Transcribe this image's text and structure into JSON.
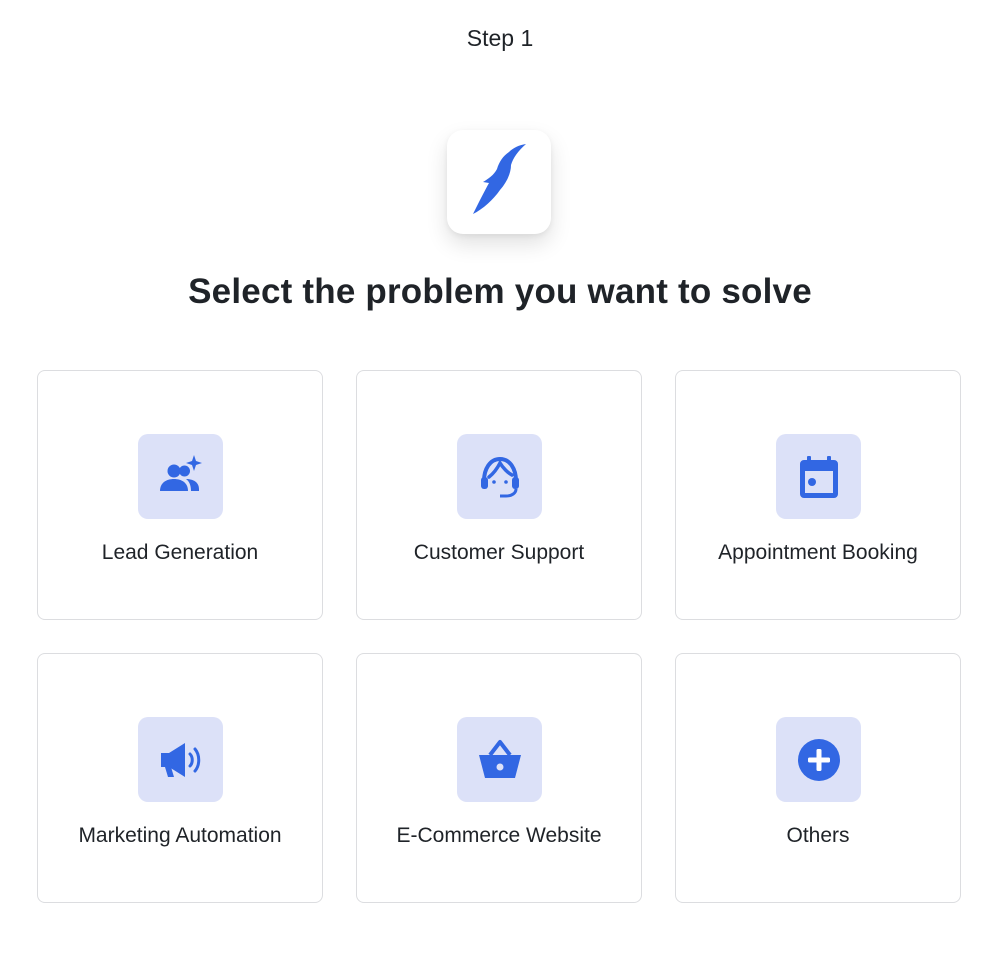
{
  "header": {
    "step_label": "Step 1"
  },
  "main": {
    "title": "Select the problem you want to solve"
  },
  "colors": {
    "accent": "#3267e3",
    "icon_bg": "#dce1f8",
    "border": "#dcdde0",
    "text": "#1f2328"
  },
  "options": [
    {
      "label": "Lead Generation",
      "icon": "users-sparkle-icon"
    },
    {
      "label": "Customer Support",
      "icon": "headset-icon"
    },
    {
      "label": "Appointment Booking",
      "icon": "calendar-icon"
    },
    {
      "label": "Marketing Automation",
      "icon": "megaphone-icon"
    },
    {
      "label": "E-Commerce Website",
      "icon": "basket-icon"
    },
    {
      "label": "Others",
      "icon": "plus-circle-icon"
    }
  ]
}
